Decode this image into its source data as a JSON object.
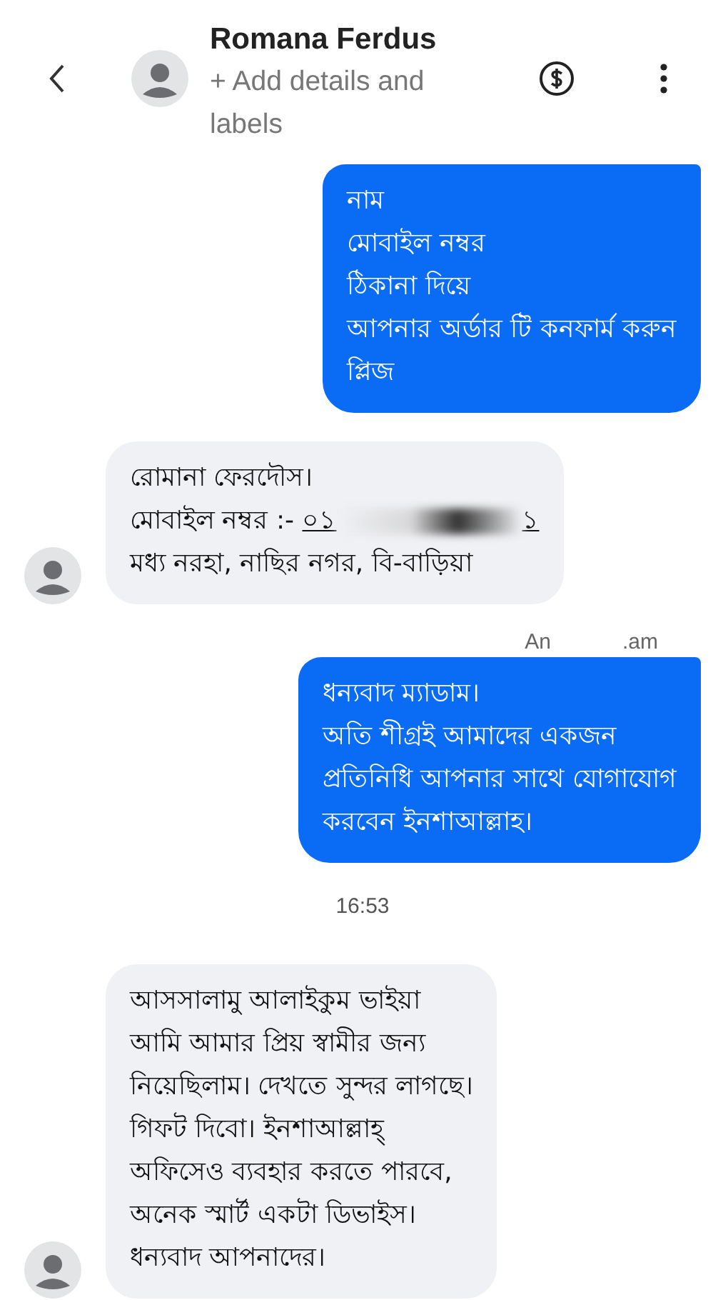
{
  "header": {
    "name": "Romana Ferdus",
    "subtitle": "+ Add details and labels"
  },
  "messages": [
    {
      "kind": "outgoing",
      "lines": [
        {
          "text": "নাম"
        },
        {
          "text": "মোবাইল নম্বর"
        },
        {
          "text": "ঠিকানা দিয়ে"
        },
        {
          "text": "আপনার অর্ডার টি কনফার্ম করুন"
        },
        {
          "text": "প্লিজ"
        }
      ]
    },
    {
      "kind": "incoming",
      "lines": [
        {
          "text": "রোমানা ফেরদৌস।"
        },
        {
          "kind": "redacted",
          "before": "মোবাইল নম্বর :- ",
          "link": "০১",
          "after": "১"
        },
        {
          "text": "মধ্য নরহা, নাছির নগর, বি-বাড়িয়া"
        }
      ]
    },
    {
      "kind": "sender",
      "before": "An",
      "after": ".am"
    },
    {
      "kind": "outgoing",
      "lines": [
        {
          "text": "ধন্যবাদ ম্যাডাম।"
        },
        {
          "text": "অতি শীগ্রই আমাদের একজন"
        },
        {
          "text": "প্রতিনিধি আপনার সাথে যোগাযোগ"
        },
        {
          "text": "করবেন ইনশাআল্লাহ।"
        }
      ]
    },
    {
      "kind": "time",
      "text": "16:53"
    },
    {
      "kind": "incoming",
      "lines": [
        {
          "text": "আসসালামু আলাইকুম ভাইয়া"
        },
        {
          "text": "আমি আমার প্রিয় স্বামীর জন্য"
        },
        {
          "text": "নিয়েছিলাম। দেখতে সুন্দর লাগছে।"
        },
        {
          "text": "গিফট দিবো। ইনশাআল্লাহ্"
        },
        {
          "text": "অফিসেও ব্যবহার করতে পারবে,"
        },
        {
          "text": "অনেক স্মার্ট একটা ডিভাইস।"
        },
        {
          "text": "ধন্যবাদ আপনাদের।"
        }
      ]
    }
  ]
}
